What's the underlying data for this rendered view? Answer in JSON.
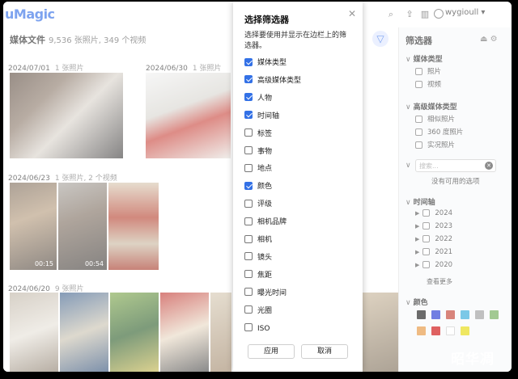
{
  "app": {
    "logo": "uMagic",
    "user": "wygioull"
  },
  "main": {
    "title": "媒体文件",
    "count": "9,536 张照片, 349 个视频",
    "groups": [
      {
        "date": "2024/07/01",
        "count": "1 张照片"
      },
      {
        "date": "2024/06/30",
        "count": "1 张照片"
      },
      {
        "date": "2024/06/23",
        "count": "1 张照片, 2 个视频"
      },
      {
        "date": "2024/06/20",
        "count": "9 张照片"
      }
    ],
    "durations": [
      "00:15",
      "00:54"
    ]
  },
  "dialog": {
    "title": "选择筛选器",
    "description": "选择要使用并显示在边栏上的筛选器。",
    "options": [
      {
        "label": "媒体类型",
        "checked": true
      },
      {
        "label": "高级媒体类型",
        "checked": true
      },
      {
        "label": "人物",
        "checked": true
      },
      {
        "label": "时间轴",
        "checked": true
      },
      {
        "label": "标签",
        "checked": false
      },
      {
        "label": "事物",
        "checked": false
      },
      {
        "label": "地点",
        "checked": false
      },
      {
        "label": "颜色",
        "checked": true
      },
      {
        "label": "评级",
        "checked": false
      },
      {
        "label": "相机品牌",
        "checked": false
      },
      {
        "label": "相机",
        "checked": false
      },
      {
        "label": "镜头",
        "checked": false
      },
      {
        "label": "焦距",
        "checked": false
      },
      {
        "label": "曝光时间",
        "checked": false
      },
      {
        "label": "光圈",
        "checked": false
      },
      {
        "label": "ISO",
        "checked": false
      }
    ],
    "apply": "应用",
    "cancel": "取消"
  },
  "sidebar": {
    "title": "筛选器",
    "media_type": {
      "title": "媒体类型",
      "items": [
        "照片",
        "视频"
      ]
    },
    "adv_media": {
      "title": "高级媒体类型",
      "items": [
        "相似照片",
        "360 度照片",
        "实况照片"
      ]
    },
    "people": {
      "search_placeholder": "搜索...",
      "empty": "没有可用的选项"
    },
    "timeline": {
      "title": "时间轴",
      "years": [
        "2024",
        "2023",
        "2022",
        "2021",
        "2020"
      ],
      "more": "查看更多"
    },
    "colors": {
      "title": "颜色",
      "swatches": [
        "#111111",
        "#1b2fd0",
        "#c0392b",
        "#2aa7d8",
        "#9a9a9a",
        "#6aa84f",
        "#e69138",
        "#cc0000",
        "#ffffff",
        "#e6d800"
      ]
    }
  },
  "watermark": "昭华凋"
}
